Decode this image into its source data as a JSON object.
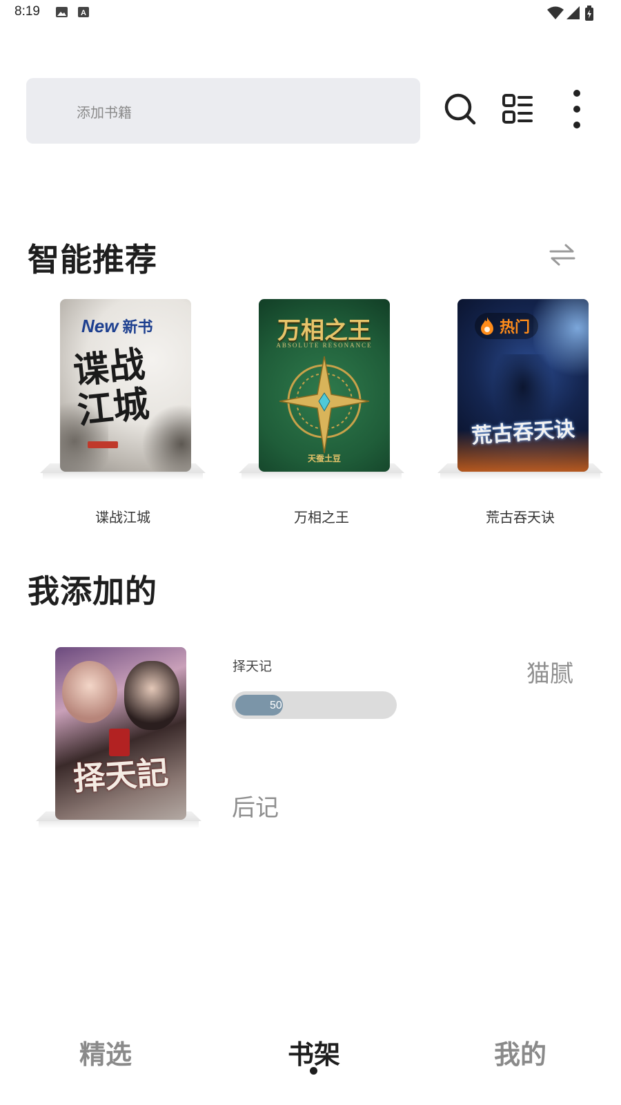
{
  "status": {
    "time": "8:19"
  },
  "search": {
    "placeholder": "添加书籍"
  },
  "icons": {
    "search": "search-icon",
    "layout": "list-layout-icon",
    "more": "more-vertical-icon",
    "swap": "swap-icon"
  },
  "sections": {
    "recommend_title": "智能推荐",
    "added_title": "我添加的"
  },
  "recommended": [
    {
      "name": "谍战江城",
      "cover_text": "谍战江城",
      "badge": "新书",
      "badge_prefix": "New"
    },
    {
      "name": "万相之王",
      "cover_text": "万相之王",
      "cover_subtitle": "ABSOLUTE RESONANCE",
      "author": "天蚕土豆"
    },
    {
      "name": "荒古吞天诀",
      "cover_text": "荒古吞天诀",
      "badge": "热门"
    }
  ],
  "added": {
    "title": "择天记",
    "cover_text": "择天記",
    "progress": 50,
    "progress_label": "50",
    "author": "猫腻",
    "last_chapter": "后记"
  },
  "nav": {
    "items": [
      "精选",
      "书架",
      "我的"
    ],
    "active": 1
  },
  "colors": {
    "accent": "#7b95a8",
    "active_nav": "#1e1e1e",
    "inactive_nav": "#8a8a8a"
  }
}
